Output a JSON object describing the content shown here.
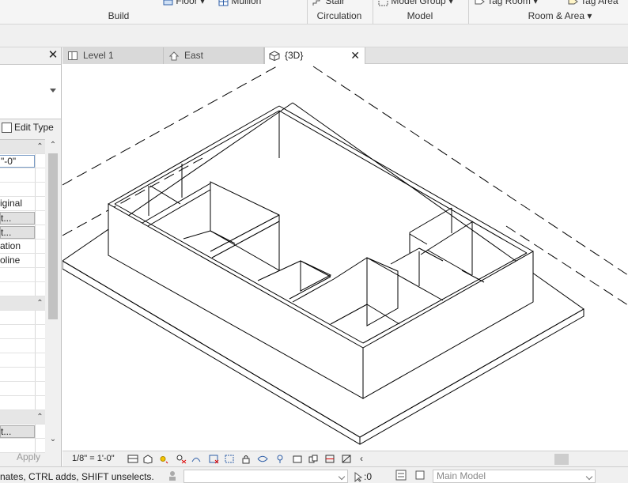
{
  "ribbon": {
    "items": {
      "floor": "Floor",
      "mullion": "Mullion",
      "stair": "Stair",
      "model_group": "Model Group",
      "tag_room": "Tag Room",
      "tag_area": "Tag Area"
    },
    "groups": {
      "build": "Build",
      "circulation": "Circulation",
      "model": "Model",
      "room_area": "Room & Area"
    }
  },
  "properties": {
    "close": "✕",
    "edit_type": "Edit Type",
    "rows": {
      "r1": "\"-0\"",
      "r2": "",
      "r3": "",
      "r4": "iginal",
      "r5": "t...",
      "r6": "t...",
      "r7": "ation",
      "r8": "oline",
      "r9": "",
      "r10": "",
      "r11": "",
      "r12": "",
      "r13": "",
      "r14": "",
      "r15": "",
      "r16": "t..."
    },
    "apply": "Apply"
  },
  "tabs": [
    {
      "label": "Level 1",
      "icon": "floor-plan-icon"
    },
    {
      "label": "East",
      "icon": "elevation-icon"
    },
    {
      "label": "{3D}",
      "icon": "3d-view-icon",
      "close": "✕"
    }
  ],
  "view_bar": {
    "scale": "1/8\" = 1'-0\"",
    "chevron": "‹"
  },
  "status_bar": {
    "hint": "nates, CTRL adds, SHIFT unselects.",
    "zero": ":0",
    "model_placeholder": "Main Model"
  },
  "colors": {
    "accent_blue": "#2f5fa8",
    "panel_bg": "#f0f0f0",
    "tab_inactive": "#d9d9d9"
  }
}
